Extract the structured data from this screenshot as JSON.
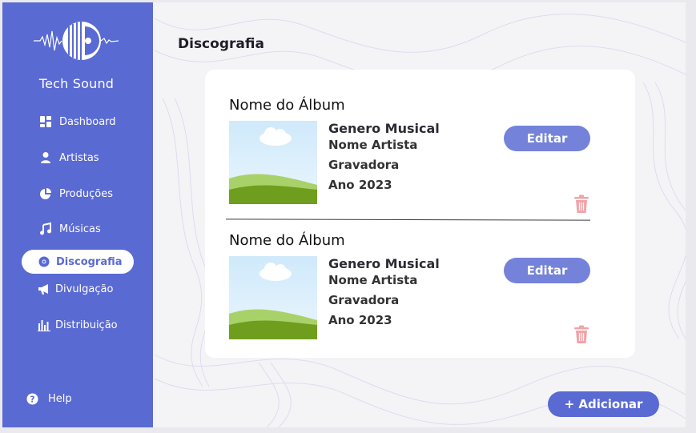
{
  "brand": {
    "name": "Tech Sound"
  },
  "sidebar": {
    "items": [
      {
        "label": "Dashboard",
        "icon": "dashboard-icon"
      },
      {
        "label": "Artistas",
        "icon": "user-icon"
      },
      {
        "label": "Produções",
        "icon": "pie-chart-icon"
      },
      {
        "label": "Músicas",
        "icon": "music-note-icon"
      },
      {
        "label": "Discografia",
        "icon": "disc-icon",
        "active": true
      },
      {
        "label": "Divulgação",
        "icon": "megaphone-icon"
      },
      {
        "label": "Distribuição",
        "icon": "bar-chart-icon"
      }
    ],
    "help": {
      "label": "Help",
      "icon": "help-circle-icon"
    }
  },
  "main": {
    "title": "Discografia",
    "albums": [
      {
        "title": "Nome do Álbum",
        "genre": "Genero Musical",
        "artist": "Nome Artista",
        "label": "Gravadora",
        "year": "Ano 2023",
        "edit_label": "Editar"
      },
      {
        "title": "Nome do Álbum",
        "genre": "Genero Musical",
        "artist": "Nome Artista",
        "label": "Gravadora",
        "year": "Ano 2023",
        "edit_label": "Editar"
      }
    ],
    "add_label": "+ Adicionar"
  },
  "colors": {
    "sidebar": "#5a6ad3",
    "button": "#7482d9",
    "trash": "#f2a3a8",
    "background": "#f4f4f7"
  }
}
